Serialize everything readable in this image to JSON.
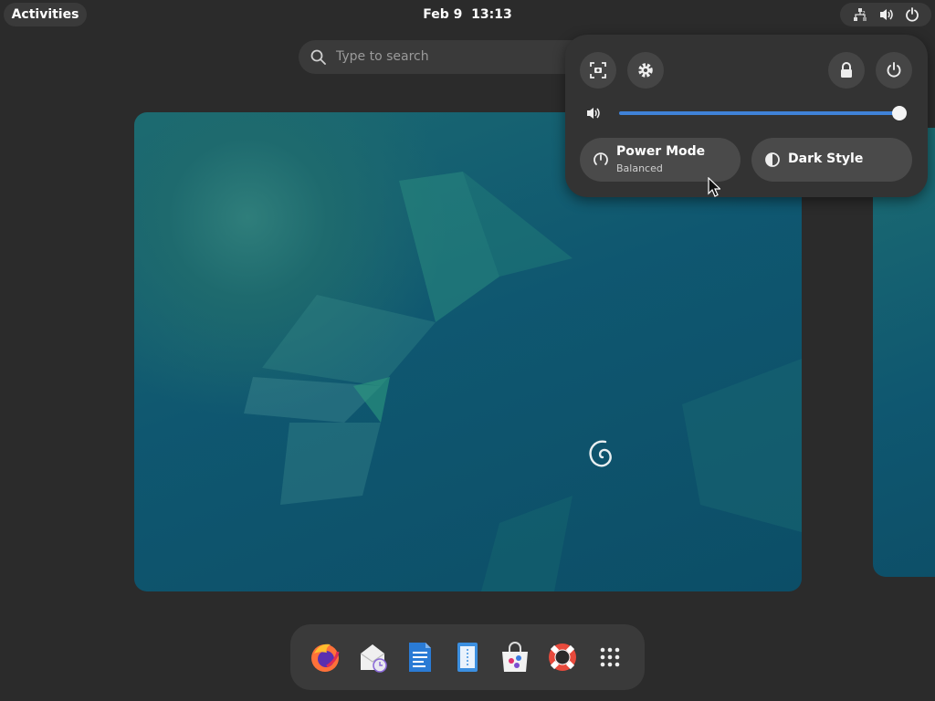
{
  "topbar": {
    "activities_label": "Activities",
    "date": "Feb 9",
    "time": "13:13",
    "indicators": [
      "network-icon",
      "volume-icon",
      "power-icon"
    ]
  },
  "search": {
    "placeholder": "Type to search"
  },
  "quick_settings": {
    "top_buttons": [
      "screenshot-icon",
      "gear-icon",
      "lock-icon",
      "power-icon"
    ],
    "volume_level": 1.0,
    "toggles": [
      {
        "title": "Power Mode",
        "subtitle": "Balanced",
        "icon": "power-mode-icon"
      },
      {
        "title": "Dark Style",
        "subtitle": "",
        "icon": "dark-style-icon"
      }
    ],
    "accent_color": "#3f82d8"
  },
  "dock": {
    "apps": [
      "firefox-icon",
      "evolution-icon",
      "writer-icon",
      "text-editor-icon",
      "software-icon",
      "help-icon",
      "app-grid-icon"
    ]
  }
}
